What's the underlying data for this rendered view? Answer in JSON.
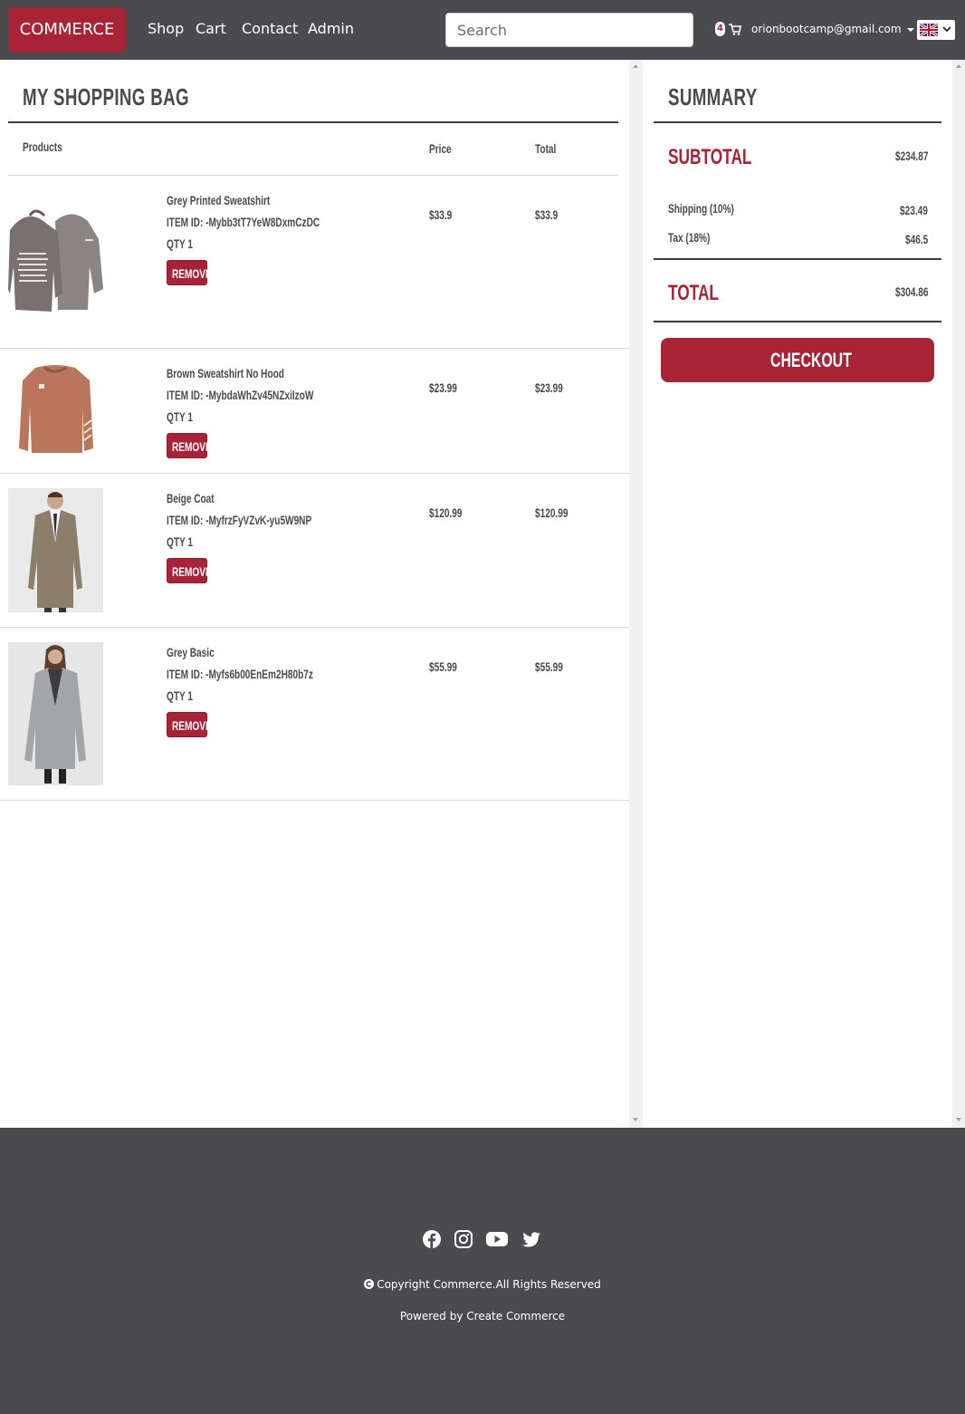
{
  "nav": {
    "brand": "COMMERCE",
    "links": [
      "Shop",
      "Cart",
      "Contact",
      "Admin"
    ],
    "search_placeholder": "Search",
    "cart_count": "4",
    "user_email": "orionbootcamp@gmail.com",
    "language_flag": "uk-flag-icon"
  },
  "bag": {
    "title": "MY SHOPPING BAG",
    "columns": {
      "products": "Products",
      "price": "Price",
      "total": "Total"
    },
    "remove_label": "REMOVE",
    "items": [
      {
        "name": "Grey Printed Sweatshirt",
        "item_id": "ITEM ID: -Mybb3tT7YeW8DxmCzDC",
        "qty": "QTY 1",
        "price": "$33.9",
        "total": "$33.9"
      },
      {
        "name": "Brown Sweatshirt No Hood",
        "item_id": "ITEM ID: -MybdaWhZv45NZxiIzoW",
        "qty": "QTY 1",
        "price": "$23.99",
        "total": "$23.99"
      },
      {
        "name": "Beige Coat",
        "item_id": "ITEM ID: -MyfrzFyVZvK-yu5W9NP",
        "qty": "QTY 1",
        "price": "$120.99",
        "total": "$120.99"
      },
      {
        "name": "Grey Basic",
        "item_id": "ITEM ID: -Myfs6b00EnEm2H80b7z",
        "qty": "QTY 1",
        "price": "$55.99",
        "total": "$55.99"
      }
    ]
  },
  "summary": {
    "title": "SUMMARY",
    "subtotal_label": "SUBTOTAL",
    "subtotal_value": "$234.87",
    "shipping_label": "Shipping (10%)",
    "shipping_value": "$23.49",
    "tax_label": "Tax (18%)",
    "tax_value": "$46.5",
    "total_label": "TOTAL",
    "total_value": "$304.86",
    "checkout_label": "CHECKOUT"
  },
  "footer": {
    "social_icons": [
      "facebook-icon",
      "instagram-icon",
      "youtube-icon",
      "twitter-icon"
    ],
    "copyright": "Copyright Commerce.All Rights Reserved",
    "powered": "Powered by Create Commerce"
  },
  "colors": {
    "brand": "#a82336",
    "navbar": "#4b4b4f",
    "text": "#4a4a4e"
  }
}
